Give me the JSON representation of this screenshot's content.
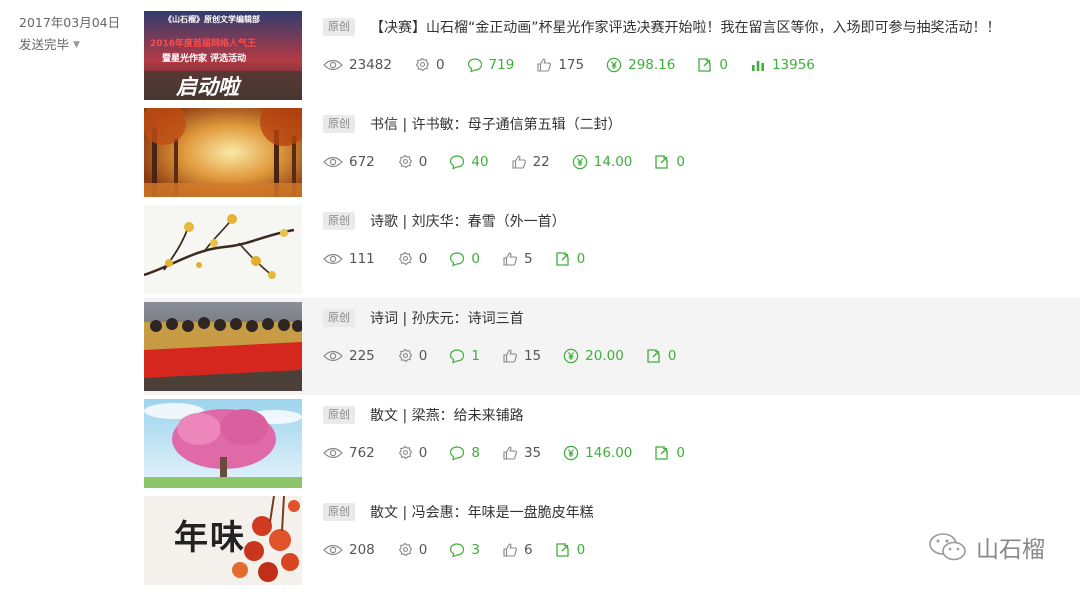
{
  "side": {
    "date": "2017年03月04日",
    "status": "发送完毕"
  },
  "articles": [
    {
      "tag": "原创",
      "title": "【决赛】山石榴“金正动画”杯星光作家评选决赛开始啦！我在留言区等你，入场即可参与抽奖活动！！",
      "thumb_lines": [
        "《山石榴》原创文学编辑部",
        "2016年度首届网络人气王",
        "暨星光作家  评选活动",
        "启动啦"
      ],
      "views": "23482",
      "shares": "0",
      "comments": "719",
      "likes": "175",
      "reward": "298.16",
      "forwards": "0",
      "reads": "13956"
    },
    {
      "tag": "原创",
      "title": "书信 | 许书敏：母子通信第五辑（二封）",
      "views": "672",
      "shares": "0",
      "comments": "40",
      "likes": "22",
      "reward": "14.00",
      "forwards": "0"
    },
    {
      "tag": "原创",
      "title": "诗歌 | 刘庆华：春雪（外一首）",
      "views": "111",
      "shares": "0",
      "comments": "0",
      "likes": "5",
      "forwards": "0"
    },
    {
      "tag": "原创",
      "title": "诗词 | 孙庆元：诗词三首",
      "views": "225",
      "shares": "0",
      "comments": "1",
      "likes": "15",
      "reward": "20.00",
      "forwards": "0"
    },
    {
      "tag": "原创",
      "title": "散文 | 梁燕：给未来铺路",
      "views": "762",
      "shares": "0",
      "comments": "8",
      "likes": "35",
      "reward": "146.00",
      "forwards": "0"
    },
    {
      "tag": "原创",
      "title": "散文 | 冯会惠：年味是一盘脆皮年糕",
      "thumb_lines": [
        "年味"
      ],
      "views": "208",
      "shares": "0",
      "comments": "3",
      "likes": "6",
      "forwards": "0"
    }
  ],
  "watermark": "山石榴",
  "colors": {
    "accent": "#3fae3a",
    "text": "#333333",
    "muted": "#888888"
  }
}
